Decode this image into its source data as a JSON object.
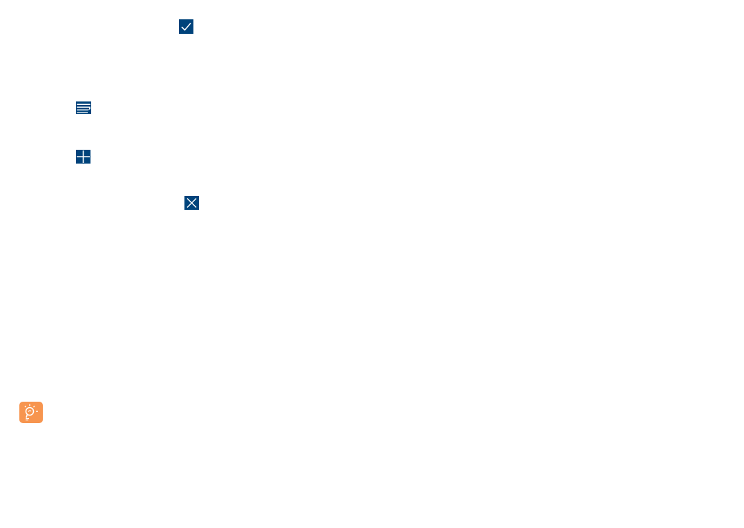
{
  "colors": {
    "icon_blue": "#00437b",
    "tip_orange": "#f7954f",
    "background": "#ffffff"
  },
  "icons": [
    {
      "name": "check-icon",
      "glyph": "checkmark"
    },
    {
      "name": "menu-icon",
      "glyph": "stacked-lines"
    },
    {
      "name": "plus-icon",
      "glyph": "plus"
    },
    {
      "name": "close-icon",
      "glyph": "x"
    },
    {
      "name": "tip-lightbulb-icon",
      "glyph": "lightbulb"
    }
  ]
}
